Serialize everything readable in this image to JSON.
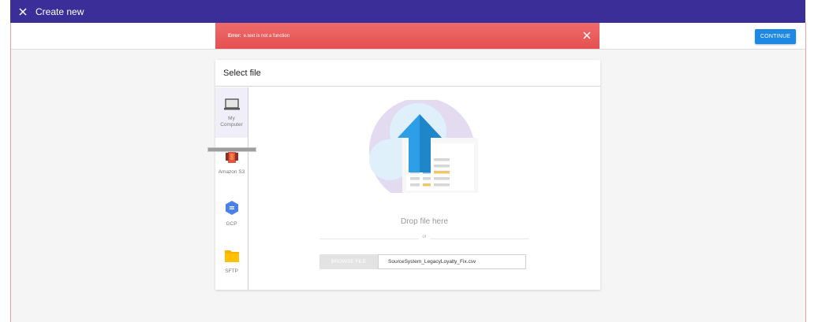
{
  "header": {
    "title": "Create new",
    "close_icon": "close-icon",
    "color": "#3b2e99"
  },
  "toolbar": {
    "continue_label": "CONTINUE",
    "accent": "#1e88e5"
  },
  "error": {
    "label": "Error:",
    "message": "e.text is not a function",
    "close_icon": "close-icon",
    "color": "#e55050"
  },
  "card": {
    "title": "Select file"
  },
  "sources": [
    {
      "label_line1": "My",
      "label_line2": "Computer",
      "icon": "laptop-icon"
    },
    {
      "label_line1": "Amazon S3",
      "icon": "amazon-s3-icon"
    },
    {
      "label_line1": "GCP",
      "icon": "gcp-icon"
    },
    {
      "label_line1": "SFTP",
      "icon": "folder-icon"
    }
  ],
  "drop": {
    "text": "Drop file here",
    "or": "or",
    "browse_label": "BROWSE FILE",
    "file_name": "SourceSystem_LegacyLoyalty_Fix.csv",
    "illustration_icon": "upload-cloud-icon"
  }
}
